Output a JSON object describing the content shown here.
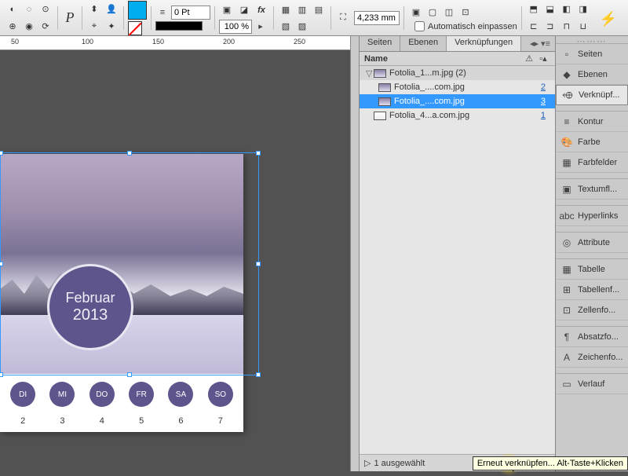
{
  "toolbar": {
    "stroke_pt": "0 Pt",
    "opacity": "100 %",
    "measure": "4,233 mm",
    "auto_fit": "Automatisch einpassen"
  },
  "ruler": {
    "t50": "50",
    "t100": "100",
    "t150": "150",
    "t200": "200",
    "t250": "250"
  },
  "calendar": {
    "month": "Februar",
    "year": "2013",
    "days": [
      "DI",
      "MI",
      "DO",
      "FR",
      "SA",
      "SO"
    ],
    "dates": [
      "2",
      "3",
      "4",
      "5",
      "6",
      "7"
    ]
  },
  "links_panel": {
    "tabs": {
      "seiten": "Seiten",
      "ebenen": "Ebenen",
      "verkn": "Verknüpfungen"
    },
    "col_name": "Name",
    "items": {
      "parent": "Fotolia_1...m.jpg (2)",
      "child1": {
        "name": "Fotolia_....com.jpg",
        "count": "2"
      },
      "child2": {
        "name": "Fotolia_....com.jpg",
        "count": "3"
      },
      "sibling": {
        "name": "Fotolia_4...a.com.jpg",
        "count": "1"
      }
    },
    "selected_status": "1 ausgewählt"
  },
  "tooltip": "Erneut verknüpfen... Alt-Taste+Klicken",
  "rail": {
    "seiten": "Seiten",
    "ebenen": "Ebenen",
    "verkn": "Verknüpf...",
    "kontur": "Kontur",
    "farbe": "Farbe",
    "farbfelder": "Farbfelder",
    "textumfl": "Textumfl...",
    "hyperlinks": "Hyperlinks",
    "attribute": "Attribute",
    "tabelle": "Tabelle",
    "tabellenf": "Tabellenf...",
    "zellenfo": "Zellenfo...",
    "absatzfo": "Absatzfo...",
    "zeichenfo": "Zeichenfo...",
    "verlauf": "Verlauf"
  }
}
